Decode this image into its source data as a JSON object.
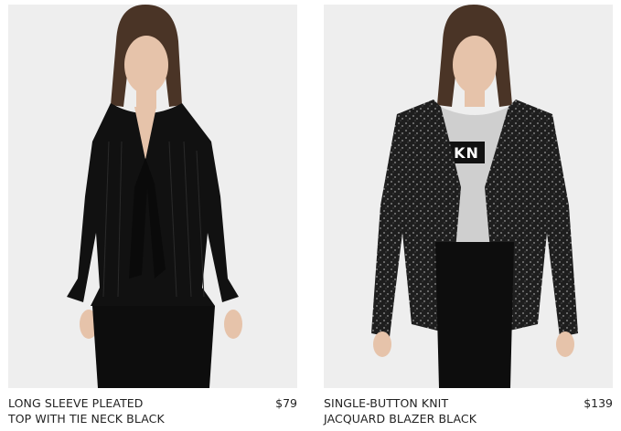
{
  "products": [
    {
      "name_line1": "LONG SLEEVE PLEATED",
      "name_line2": "TOP WITH TIE NECK BLACK",
      "price": "$79"
    },
    {
      "name_line1": "SINGLE-BUTTON KNIT",
      "name_line2": "JACQUARD BLAZER BLACK",
      "price": "$139",
      "shirt_print": "KN"
    }
  ],
  "colors": {
    "image_background": "#eeeeee",
    "garment": "#111111",
    "text": "#222222"
  }
}
